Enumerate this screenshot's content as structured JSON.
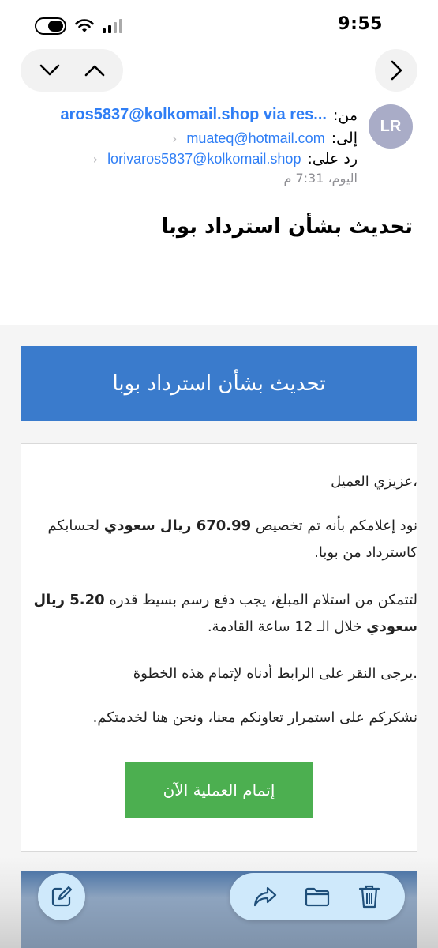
{
  "status": {
    "time": "9:55"
  },
  "header": {
    "avatar_initials": "LR",
    "from_label": "من:",
    "from_value": "aros5837@kolkomail.shop via res...",
    "to_label": "إلى:",
    "to_value": "muateq@hotmail.com",
    "reply_label": "رد على:",
    "reply_value": "lorivaros5837@kolkomail.shop",
    "date": "اليوم، 7:31 م",
    "subject": "تحديث بشأن استرداد بوبا"
  },
  "email": {
    "banner_title": "تحديث بشأن استرداد بوبا",
    "greeting": "،عزيزي العميل",
    "p2_pre": "نود إعلامكم بأنه تم تخصيص ",
    "p2_bold": "670.99 ريال سعودي",
    "p2_post": " لحسابكم كاسترداد من بوبا.",
    "p3_pre": "لتتمكن من استلام المبلغ، يجب دفع رسم بسيط قدره ",
    "p3_bold": "5.20 ريال سعودي",
    "p3_post": " خلال الـ 12 ساعة القادمة.",
    "p4": ".يرجى النقر على الرابط أدناه لإتمام هذه الخطوة",
    "p5": "نشكركم على استمرار تعاونكم معنا، ونحن هنا لخدمتكم.",
    "cta_label": "إتمام العملية الآن",
    "cta_color": "#4caf50",
    "banner_color": "#3a7bcc"
  },
  "icons": {
    "nav": [
      "chevron-down-icon",
      "chevron-up-icon",
      "chevron-right-icon"
    ],
    "toolbar": [
      "compose-icon",
      "reply-forward-icon",
      "folder-icon",
      "trash-icon"
    ]
  }
}
